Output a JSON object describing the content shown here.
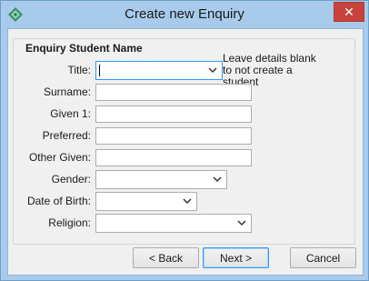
{
  "window": {
    "title": "Create new Enquiry",
    "close_glyph": "✕"
  },
  "icons": {
    "app": "app-diamond-icon",
    "close": "close-icon",
    "dropdown": "chevron-down-icon"
  },
  "group": {
    "title": "Enquiry Student Name",
    "note": "Leave details blank to not create a student"
  },
  "fields": {
    "title": {
      "label": "Title:",
      "value": ""
    },
    "surname": {
      "label": "Surname:",
      "value": ""
    },
    "given1": {
      "label": "Given 1:",
      "value": ""
    },
    "preferred": {
      "label": "Preferred:",
      "value": ""
    },
    "other_given": {
      "label": "Other Given:",
      "value": ""
    },
    "gender": {
      "label": "Gender:",
      "value": ""
    },
    "dob": {
      "label": "Date of Birth:",
      "value": ""
    },
    "religion": {
      "label": "Religion:",
      "value": ""
    }
  },
  "buttons": {
    "back": "< Back",
    "next": "Next >",
    "cancel": "Cancel"
  },
  "colors": {
    "titlebar": "#a9cbeb",
    "close": "#c7433c",
    "focus": "#3399ff"
  }
}
